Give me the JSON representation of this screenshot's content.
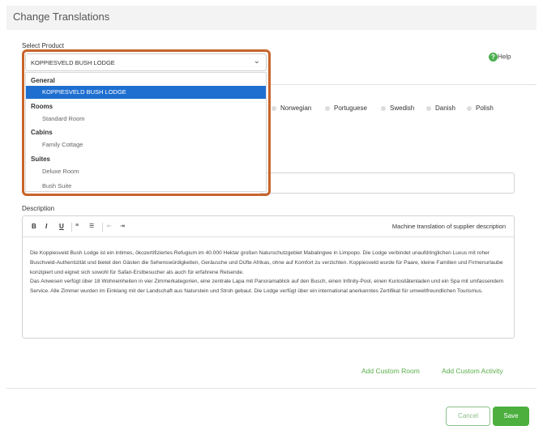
{
  "header": {
    "title": "Change Translations"
  },
  "select_product": {
    "label": "Select Product",
    "value": "KOPPIESVELD BUSH LODGE",
    "groups": [
      {
        "name": "General",
        "items": [
          "KOPPIESVELD BUSH LODGE"
        ]
      },
      {
        "name": "Rooms",
        "items": [
          "Standard Room"
        ]
      },
      {
        "name": "Cabins",
        "items": [
          "Family Cottage"
        ]
      },
      {
        "name": "Suites",
        "items": [
          "Deluxe Room",
          "Bush Suite"
        ]
      }
    ]
  },
  "help": {
    "label": "Help",
    "icon": "question-circle-icon"
  },
  "languages": [
    "Norwegian",
    "Portuguese",
    "Swedish",
    "Danish",
    "Polish"
  ],
  "description": {
    "label": "Description",
    "toolbar": {
      "bold": "B",
      "italic": "I",
      "underline": "U",
      "machine_translation": "Machine translation of supplier description"
    },
    "paragraph1": "Die Koppiesveld Bush Lodge ist ein intimes, ökozertifiziertes Refugium im 40.000 Hektar großen Naturschutzgebiet Mabalingwe in Limpopo. Die Lodge verbindet unaufdringlichen Luxus mit roher Buschveld-Authentizität und bietet den Gästen die Sehenswürdigkeiten, Geräusche und Düfte Afrikas, ohne auf Komfort zu verzichten. Koppiesveld wurde für Paare, kleine Familien und Firmenurlaube konzipiert und eignet sich sowohl für Safari-Erstbesucher als auch für erfahrene Reisende.",
    "paragraph2": "Das Anwesen verfügt über 18 Wohneinheiten in vier Zimmerkategorien, eine zentrale Lapa mit Panoramablick auf den Busch, einen Infinity-Pool, einen Kuriositätenladen und ein Spa mit umfassendem Service. Alle Zimmer wurden im Einklang mit der Landschaft aus Naturstein und Stroh gebaut. Die Lodge verfügt über ein international anerkanntes Zertifikat für umweltfreundlichen Tourismus."
  },
  "links": {
    "add_room": "Add Custom Room",
    "add_activity": "Add Custom Activity"
  },
  "buttons": {
    "cancel": "Cancel",
    "save": "Save"
  },
  "colors": {
    "accent_green": "#4caf3e",
    "selected_blue": "#1f6fd1",
    "highlight_orange": "#c8642a"
  }
}
